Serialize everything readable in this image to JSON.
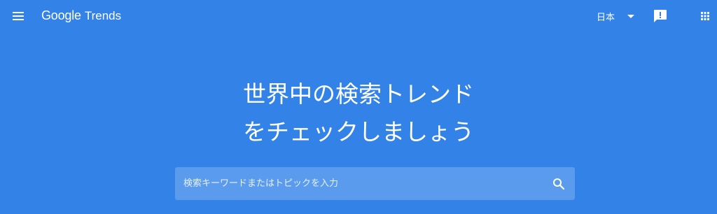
{
  "header": {
    "logo_brand": "Google",
    "logo_product": "Trends",
    "menu_icon": "hamburger-menu-icon",
    "language_label": "日本",
    "language_icon": "dropdown-caret-icon",
    "feedback_icon": "feedback-icon",
    "apps_icon": "apps-grid-icon"
  },
  "hero": {
    "headline_line1": "世界中の検索トレンド",
    "headline_line2": "をチェックしましょう"
  },
  "search": {
    "placeholder": "検索キーワードまたはトピックを入力",
    "value": "",
    "icon": "search-icon"
  },
  "colors": {
    "background": "#3282e8",
    "search_box": "#5a9bee",
    "text": "#ffffff"
  }
}
